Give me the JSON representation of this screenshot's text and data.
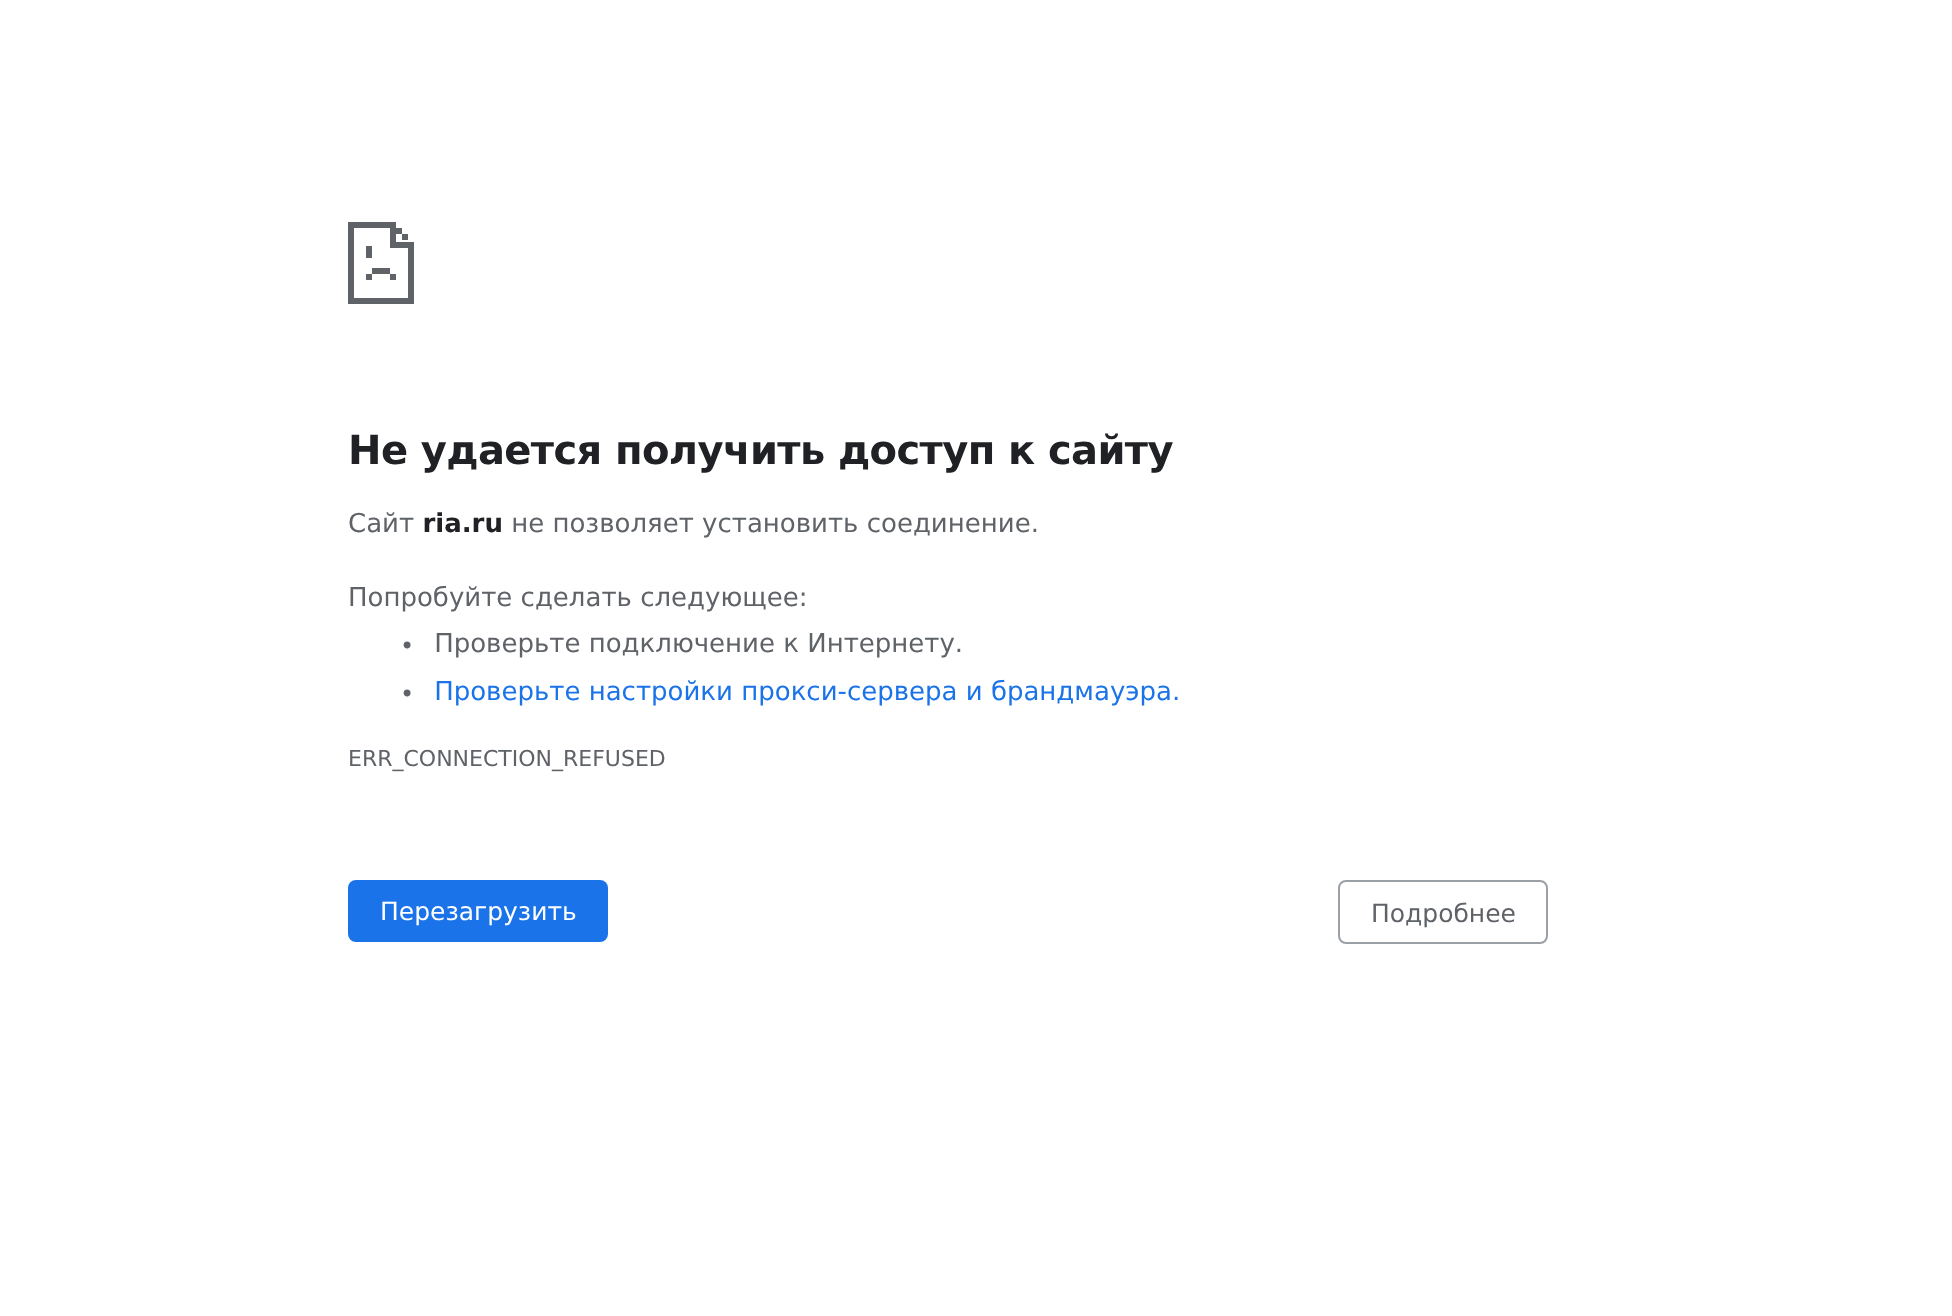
{
  "heading": "Не удается получить доступ к сайту",
  "summary": "Сайт **ria.ru** не позволяет установить соединение.",
  "suggestions_title": "Попробуйте сделать следующее:",
  "suggestions": [
    {
      "kind": "text",
      "bullet": "•",
      "text": "Проверьте подключение к Интернету."
    },
    {
      "kind": "link",
      "bullet": "•",
      "text": "Проверьте настройки прокси-сервера и брандмауэра."
    }
  ],
  "error_code": "ERR_CONNECTION_REFUSED",
  "buttons": {
    "reload": "Перезагрузить",
    "details": "Подробнее"
  }
}
